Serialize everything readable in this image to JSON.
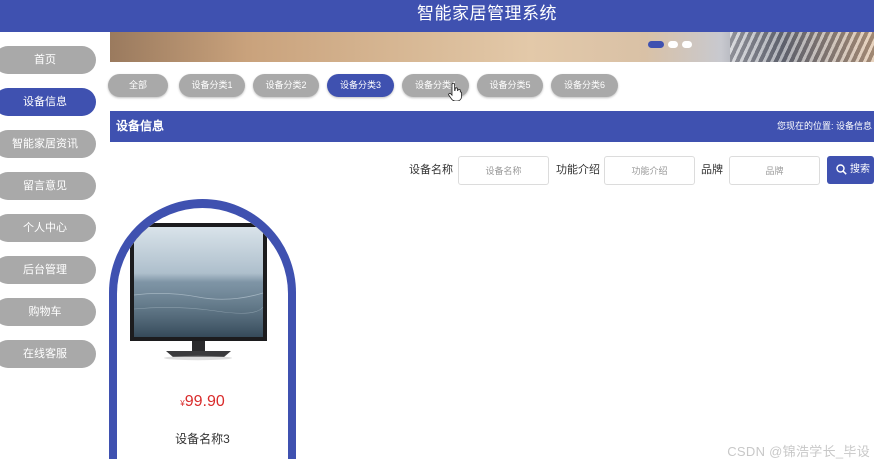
{
  "header": {
    "title": "智能家居管理系统"
  },
  "sidebar": {
    "items": [
      {
        "label": "首页"
      },
      {
        "label": "设备信息"
      },
      {
        "label": "智能家居资讯"
      },
      {
        "label": "留言意见"
      },
      {
        "label": "个人中心"
      },
      {
        "label": "后台管理"
      },
      {
        "label": "购物车"
      },
      {
        "label": "在线客服"
      }
    ],
    "active_index": 1
  },
  "carousel": {
    "slide_count": 3,
    "active_index": 0
  },
  "categories": {
    "items": [
      {
        "label": "全部"
      },
      {
        "label": "设备分类1"
      },
      {
        "label": "设备分类2"
      },
      {
        "label": "设备分类3"
      },
      {
        "label": "设备分类4"
      },
      {
        "label": "设备分类5"
      },
      {
        "label": "设备分类6"
      }
    ],
    "active_index": 3
  },
  "section": {
    "title": "设备信息",
    "breadcrumb": "您现在的位置: 设备信息"
  },
  "search": {
    "name_label": "设备名称",
    "name_placeholder": "设备名称",
    "intro_label": "功能介绍",
    "intro_placeholder": "功能介绍",
    "brand_label": "品牌",
    "brand_placeholder": "品牌",
    "button_label": "搜索"
  },
  "products": [
    {
      "name": "设备名称3",
      "currency": "¥",
      "price": "99.90"
    }
  ],
  "watermark": "CSDN @锦浩学长_毕设",
  "colors": {
    "accent": "#3f51b0",
    "inactive": "#a9a9a9",
    "price": "#d92b2b"
  }
}
